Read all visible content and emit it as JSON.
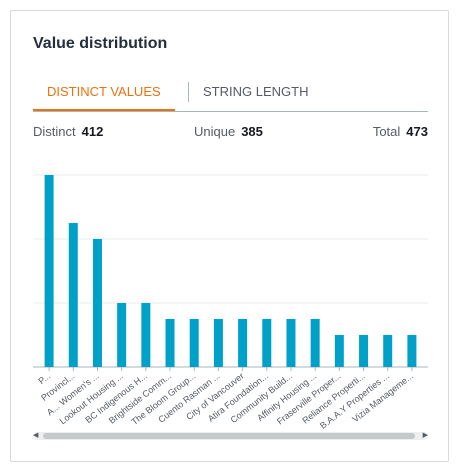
{
  "panel": {
    "title": "Value distribution"
  },
  "tabs": [
    {
      "label": "DISTINCT VALUES",
      "active": true
    },
    {
      "label": "STRING LENGTH",
      "active": false
    }
  ],
  "stats": {
    "distinct_label": "Distinct",
    "distinct_value": "412",
    "unique_label": "Unique",
    "unique_value": "385",
    "total_label": "Total",
    "total_value": "473"
  },
  "colors": {
    "bar": "#00a1c9",
    "accent": "#ec7211",
    "grid": "#eaeded"
  },
  "chart_data": {
    "type": "bar",
    "categories": [
      "P...",
      "Provincl...",
      "A... Women's ...",
      "Lookout Housing ...",
      "BC Indigenous H...",
      "Brightside Comm...",
      "The Bloom Group...",
      "Cuento Rasman ...",
      "City of Vancouver",
      "Atira Foundation...",
      "Community Build...",
      "Affinity Housing ...",
      "Fraserville Proper...",
      "Reliance Properti...",
      "B.A.A.Y Properties ...",
      "Vizia Manageme..."
    ],
    "values": [
      24,
      18,
      16,
      8,
      8,
      6,
      6,
      6,
      6,
      6,
      6,
      6,
      4,
      4,
      4,
      4
    ],
    "ylim": [
      0,
      26
    ],
    "grid": true
  }
}
